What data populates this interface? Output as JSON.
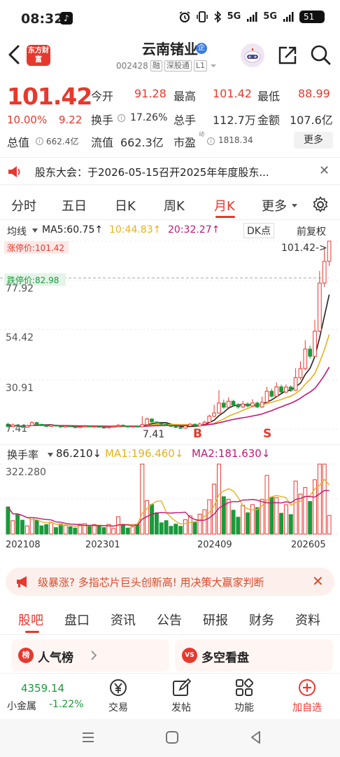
{
  "status_bar": {
    "time": "08:32",
    "network_1": "5G",
    "network_2": "5G",
    "battery": "51"
  },
  "header": {
    "brand_logo_text": "东方财富",
    "stock_name": "云南锗业",
    "verify_badge": "企",
    "stock_code": "002428",
    "tags": [
      "融",
      "深股通",
      "L1"
    ]
  },
  "quote": {
    "price": "101.42",
    "change_pct": "10.00%",
    "change": "9.22",
    "open_label": "今开",
    "open": "91.28",
    "high_label": "最高",
    "high": "101.42",
    "low_label": "最低",
    "low": "88.99",
    "turnover_label": "换手",
    "turnover": "17.26%",
    "volume_label": "总手",
    "volume": "112.7万",
    "amount_label": "金额",
    "amount": "107.6亿",
    "mcap_label": "总值",
    "mcap": "662.4亿",
    "float_label": "流值",
    "float_cap": "662.3亿",
    "pe_label": "市盈",
    "pe_sup": "动",
    "pe": "1818.34",
    "more_label": "更多"
  },
  "notice": {
    "text": "股东大会：于2026-05-15召开2025年年度股东..."
  },
  "period_tabs": {
    "items": [
      "分时",
      "五日",
      "日K",
      "周K",
      "月K",
      "更多"
    ],
    "active_index": 4
  },
  "ma_row": {
    "label": "均线",
    "ma5": "MA5:60.75↑",
    "ma10": "10:44.83↑",
    "ma20": "20:32.27↑",
    "dk": "DK点",
    "adjust": "前复权"
  },
  "kline": {
    "limit_up_label": "涨停价:101.42",
    "limit_down_label": "跌停价:82.98",
    "last_price_label": "101.42->",
    "low_marker": "7.41",
    "y_ticks": [
      "77.92",
      "54.42",
      "30.91",
      "7.41"
    ]
  },
  "volume": {
    "label": "换手率",
    "value": "86.210↓",
    "ma1": "MA1:196.460↓",
    "ma2": "MA2:181.630↓",
    "y_top": "322.280",
    "dates": [
      "202108",
      "202301",
      "202409",
      "202605"
    ]
  },
  "ad": {
    "text": "级暴涨? 多指芯片巨头创新高! 用决策大赢家判断"
  },
  "section_tabs": {
    "items": [
      "股吧",
      "盘口",
      "资讯",
      "公告",
      "研报",
      "财务",
      "资料"
    ],
    "active_index": 0
  },
  "cards": {
    "left_title": "人气榜",
    "left_icon": "榜",
    "right_title": "多空看盘",
    "right_icon": "VS"
  },
  "bottom_nav": {
    "index_value": "4359.14",
    "index_name": "小金属",
    "index_pct": "-1.22%",
    "items": [
      "交易",
      "发帖",
      "功能",
      "加自选"
    ]
  },
  "colors": {
    "accent": "#e8382d",
    "down": "#1a9a3c",
    "ma5": "#222222",
    "ma10": "#e6b220",
    "ma20": "#c01877"
  },
  "chart_data": {
    "type": "candlestick",
    "period": "monthly",
    "ylim": [
      7.41,
      101.42
    ],
    "candles": [
      {
        "o": 9.8,
        "c": 8.6,
        "h": 10.5,
        "l": 8.2
      },
      {
        "o": 8.6,
        "c": 9.4,
        "h": 10.2,
        "l": 8.3
      },
      {
        "o": 9.4,
        "c": 8.9,
        "h": 9.9,
        "l": 8.5
      },
      {
        "o": 8.9,
        "c": 8.3,
        "h": 9.2,
        "l": 7.9
      },
      {
        "o": 8.3,
        "c": 9.1,
        "h": 9.6,
        "l": 8.0
      },
      {
        "o": 9.1,
        "c": 10.6,
        "h": 11.3,
        "l": 8.9
      },
      {
        "o": 10.6,
        "c": 9.7,
        "h": 11.0,
        "l": 9.4
      },
      {
        "o": 9.7,
        "c": 9.2,
        "h": 10.1,
        "l": 8.8
      },
      {
        "o": 9.2,
        "c": 8.7,
        "h": 9.5,
        "l": 8.4
      },
      {
        "o": 8.7,
        "c": 9.3,
        "h": 9.8,
        "l": 8.5
      },
      {
        "o": 9.3,
        "c": 8.9,
        "h": 9.6,
        "l": 8.6
      },
      {
        "o": 8.9,
        "c": 8.4,
        "h": 9.1,
        "l": 8.1
      },
      {
        "o": 8.4,
        "c": 8.9,
        "h": 9.3,
        "l": 8.2
      },
      {
        "o": 8.9,
        "c": 8.5,
        "h": 9.2,
        "l": 8.3
      },
      {
        "o": 8.5,
        "c": 8.2,
        "h": 8.8,
        "l": 7.9
      },
      {
        "o": 8.2,
        "c": 8.6,
        "h": 9.0,
        "l": 8.0
      },
      {
        "o": 8.6,
        "c": 8.9,
        "h": 9.4,
        "l": 8.4
      },
      {
        "o": 8.9,
        "c": 8.5,
        "h": 9.1,
        "l": 8.3
      },
      {
        "o": 8.5,
        "c": 8.8,
        "h": 9.2,
        "l": 8.3
      },
      {
        "o": 8.8,
        "c": 8.3,
        "h": 9.0,
        "l": 8.1
      },
      {
        "o": 8.3,
        "c": 8.0,
        "h": 8.6,
        "l": 7.8
      },
      {
        "o": 8.0,
        "c": 8.4,
        "h": 8.9,
        "l": 7.9
      },
      {
        "o": 8.4,
        "c": 8.8,
        "h": 9.3,
        "l": 8.2
      },
      {
        "o": 8.8,
        "c": 9.3,
        "h": 9.8,
        "l": 8.6
      },
      {
        "o": 9.3,
        "c": 8.9,
        "h": 9.6,
        "l": 8.6
      },
      {
        "o": 8.9,
        "c": 8.4,
        "h": 9.1,
        "l": 8.2
      },
      {
        "o": 8.4,
        "c": 8.8,
        "h": 9.1,
        "l": 8.2
      },
      {
        "o": 8.8,
        "c": 8.5,
        "h": 9.0,
        "l": 8.3
      },
      {
        "o": 8.5,
        "c": 9.6,
        "h": 13.8,
        "l": 8.4
      },
      {
        "o": 9.6,
        "c": 12.4,
        "h": 13.2,
        "l": 9.3
      },
      {
        "o": 12.4,
        "c": 10.9,
        "h": 12.8,
        "l": 10.5
      },
      {
        "o": 10.9,
        "c": 10.3,
        "h": 11.2,
        "l": 9.9
      },
      {
        "o": 10.3,
        "c": 9.8,
        "h": 10.6,
        "l": 9.5
      },
      {
        "o": 9.8,
        "c": 9.2,
        "h": 10.1,
        "l": 8.9
      },
      {
        "o": 9.2,
        "c": 8.7,
        "h": 9.5,
        "l": 8.4
      },
      {
        "o": 8.7,
        "c": 8.2,
        "h": 8.9,
        "l": 7.9
      },
      {
        "o": 8.2,
        "c": 7.8,
        "h": 8.5,
        "l": 7.41
      },
      {
        "o": 7.8,
        "c": 8.9,
        "h": 9.5,
        "l": 7.6
      },
      {
        "o": 8.9,
        "c": 9.8,
        "h": 10.4,
        "l": 8.7
      },
      {
        "o": 9.8,
        "c": 8.9,
        "h": 10.1,
        "l": 8.6
      },
      {
        "o": 8.9,
        "c": 9.9,
        "h": 10.6,
        "l": 8.7
      },
      {
        "o": 9.9,
        "c": 10.8,
        "h": 11.5,
        "l": 9.6
      },
      {
        "o": 10.8,
        "c": 13.8,
        "h": 14.6,
        "l": 10.6
      },
      {
        "o": 13.8,
        "c": 15.4,
        "h": 19.5,
        "l": 13.2
      },
      {
        "o": 15.4,
        "c": 20.4,
        "h": 26.8,
        "l": 15.0
      },
      {
        "o": 20.4,
        "c": 18.3,
        "h": 22.1,
        "l": 17.5
      },
      {
        "o": 18.3,
        "c": 21.3,
        "h": 23.2,
        "l": 17.9
      },
      {
        "o": 21.3,
        "c": 19.4,
        "h": 22.0,
        "l": 18.6
      },
      {
        "o": 19.4,
        "c": 18.4,
        "h": 20.4,
        "l": 17.6
      },
      {
        "o": 18.4,
        "c": 19.9,
        "h": 21.5,
        "l": 17.8
      },
      {
        "o": 19.9,
        "c": 18.9,
        "h": 20.8,
        "l": 18.2
      },
      {
        "o": 18.9,
        "c": 20.4,
        "h": 22.3,
        "l": 18.5
      },
      {
        "o": 20.4,
        "c": 18.4,
        "h": 21.1,
        "l": 17.9
      },
      {
        "o": 18.4,
        "c": 20.8,
        "h": 23.6,
        "l": 18.0
      },
      {
        "o": 20.8,
        "c": 26.3,
        "h": 28.5,
        "l": 20.3
      },
      {
        "o": 26.3,
        "c": 23.8,
        "h": 27.6,
        "l": 23.0
      },
      {
        "o": 23.8,
        "c": 28.5,
        "h": 30.7,
        "l": 23.2
      },
      {
        "o": 28.5,
        "c": 25.9,
        "h": 29.6,
        "l": 25.1
      },
      {
        "o": 25.9,
        "c": 28.4,
        "h": 29.7,
        "l": 25.3
      },
      {
        "o": 28.4,
        "c": 26.8,
        "h": 29.2,
        "l": 26.0
      },
      {
        "o": 26.8,
        "c": 33.1,
        "h": 37.8,
        "l": 26.5
      },
      {
        "o": 33.1,
        "c": 37.6,
        "h": 41.3,
        "l": 32.0
      },
      {
        "o": 37.6,
        "c": 47.4,
        "h": 51.8,
        "l": 36.9
      },
      {
        "o": 47.4,
        "c": 43.8,
        "h": 49.2,
        "l": 42.6
      },
      {
        "o": 43.8,
        "c": 56.4,
        "h": 62.1,
        "l": 43.2
      },
      {
        "o": 56.4,
        "c": 80.4,
        "h": 86.5,
        "l": 55.9
      },
      {
        "o": 80.4,
        "c": 91.3,
        "h": 98.2,
        "l": 78.5
      },
      {
        "o": 91.3,
        "c": 101.42,
        "h": 101.42,
        "l": 88.99
      }
    ],
    "volume": [
      125,
      62,
      92,
      64,
      38,
      76,
      64,
      38,
      44,
      52,
      30,
      46,
      40,
      34,
      28,
      46,
      48,
      35,
      44,
      35,
      30,
      45,
      26,
      80,
      45,
      28,
      34,
      44,
      322,
      154,
      136,
      98,
      52,
      62,
      36,
      46,
      36,
      66,
      84,
      54,
      92,
      112,
      158,
      230,
      322,
      172,
      160,
      110,
      78,
      132,
      98,
      136,
      122,
      160,
      270,
      170,
      168,
      96,
      135,
      90,
      244,
      184,
      214,
      150,
      250,
      322,
      322,
      86
    ]
  }
}
